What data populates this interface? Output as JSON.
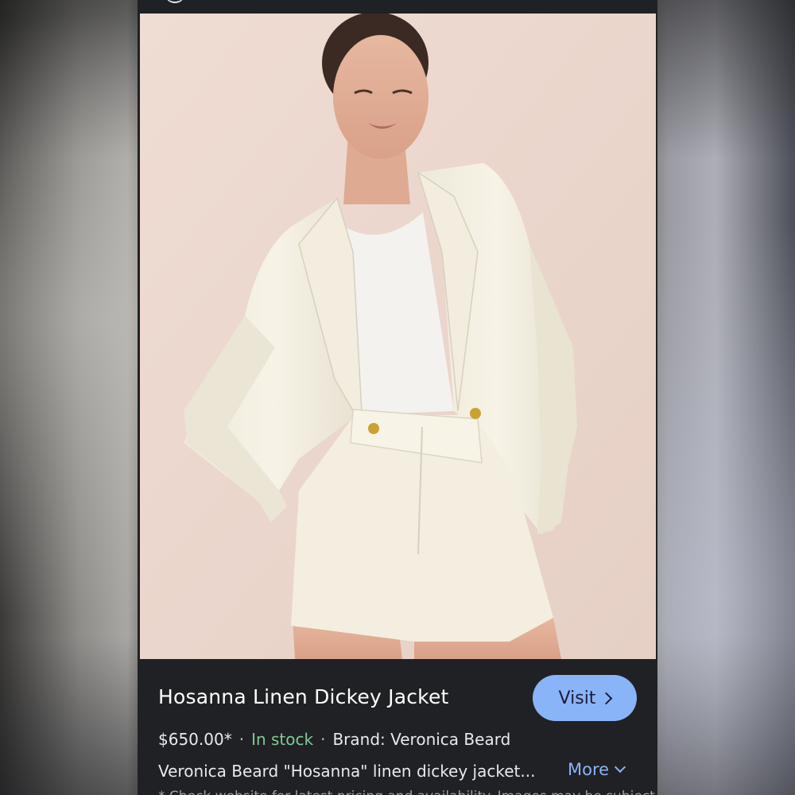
{
  "product": {
    "title": "Hosanna Linen Dickey Jacket",
    "visit_label": "Visit",
    "price": "$650.00*",
    "separator": "·",
    "stock_status": "In stock",
    "brand": "Brand: Veronica Beard",
    "description": "Veronica Beard \"Hosanna\" linen dickey jacket...",
    "more_label": "More",
    "disclaimer": "* Check website for latest pricing and availability. Images may be subject to copyright."
  },
  "colors": {
    "background": "#202124",
    "accent": "#8ab4f8",
    "stock": "#81c995"
  },
  "icons": {
    "visit": "chevron-right-icon",
    "more": "chevron-down-icon"
  }
}
